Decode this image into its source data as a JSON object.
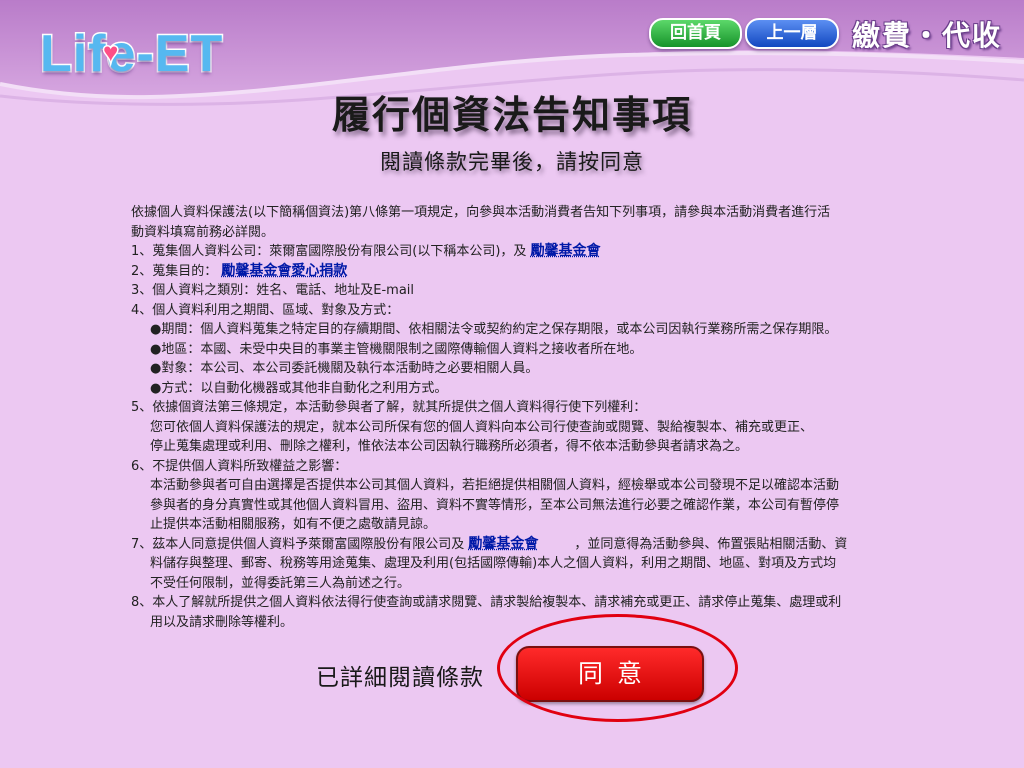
{
  "header": {
    "logo_text": "Life-ET",
    "home_label": "回首頁",
    "back_label": "上一層",
    "section_title": "繳費・代收"
  },
  "page": {
    "title": "履行個資法告知事項",
    "subtitle": "閱讀條款完畢後，請按同意"
  },
  "terms": {
    "intro_line1": "依據個人資料保護法(以下簡稱個資法)第八條第一項規定，向參與本活動消費者告知下列事項，請參與本活動消費者進行活",
    "intro_line2": "動資料填寫前務必詳閱。",
    "item1_prefix": "1、蒐集個人資料公司：萊爾富國際股份有限公司(以下稱本公司)，及",
    "item1_org": "勵馨基金會",
    "item2_prefix": "2、蒐集目的：",
    "item2_purpose": "勵馨基金會愛心捐款",
    "item3": "3、個人資料之類別：姓名、電話、地址及E-mail",
    "item4": "4、個人資料利用之期間、區域、對象及方式：",
    "item4_period": "●期間：個人資料蒐集之特定目的存續期間、依相關法令或契約約定之保存期限，或本公司因執行業務所需之保存期限。",
    "item4_region": "●地區：本國、未受中央目的事業主管機關限制之國際傳輸個人資料之接收者所在地。",
    "item4_target": "●對象：本公司、本公司委託機關及執行本活動時之必要相關人員。",
    "item4_method": "●方式：以自動化機器或其他非自動化之利用方式。",
    "item5": "5、依據個資法第三條規定，本活動參與者了解，就其所提供之個人資料得行使下列權利：",
    "item5_line1": "您可依個人資料保護法的規定，就本公司所保有您的個人資料向本公司行使查詢或閱覽、製給複製本、補充或更正、",
    "item5_line2": "停止蒐集處理或利用、刪除之權利，惟依法本公司因執行職務所必須者，得不依本活動參與者請求為之。",
    "item6": "6、不提供個人資料所致權益之影響：",
    "item6_line1": "本活動參與者可自由選擇是否提供本公司其個人資料，若拒絕提供相關個人資料，經檢舉或本公司發現不足以確認本活動",
    "item6_line2": "參與者的身分真實性或其他個人資料冒用、盜用、資料不實等情形，至本公司無法進行必要之確認作業，本公司有暫停停",
    "item6_line3": "止提供本活動相關服務，如有不便之處敬請見諒。",
    "item7_prefix": "7、茲本人同意提供個人資料予萊爾富國際股份有限公司及",
    "item7_org": "勵馨基金會",
    "item7_suffix": "，並同意得為活動參與、佈置張貼相關活動、資",
    "item7_line2": "料儲存與整理、郵寄、稅務等用途蒐集、處理及利用(包括國際傳輸)本人之個人資料，利用之期間、地區、對項及方式均",
    "item7_line3": "不受任何限制，並得委託第三人為前述之行。",
    "item8": "8、本人了解就所提供之個人資料依法得行使查詢或請求閱覽、請求製給複製本、請求補充或更正、請求停止蒐集、處理或利",
    "item8_line2": "用以及請求刪除等權利。"
  },
  "footer": {
    "confirm_label": "已詳細閱讀條款",
    "agree_label": "同意"
  },
  "colors": {
    "background": "#ecc8f2",
    "header_band": "#c98fd6",
    "highlight_text": "#0019a8",
    "agree_button": "#e60000",
    "annotation_circle": "#e10010"
  }
}
